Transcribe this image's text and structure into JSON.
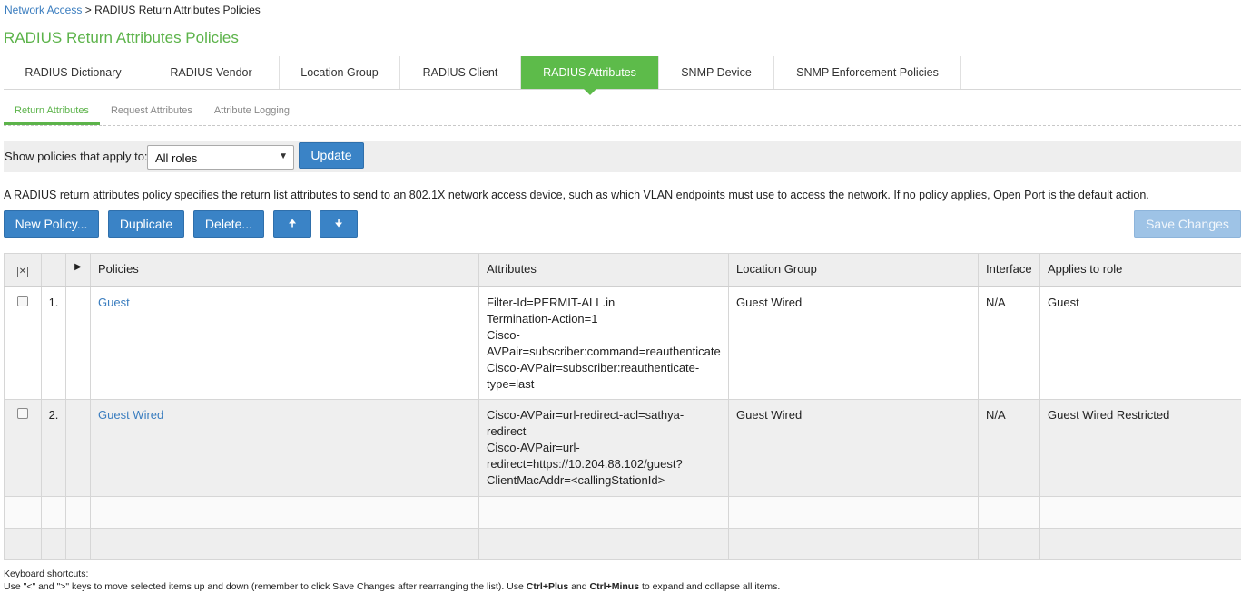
{
  "breadcrumb": {
    "link": "Network Access",
    "separator": ">",
    "current": "RADIUS Return Attributes Policies"
  },
  "page_title": "RADIUS Return Attributes Policies",
  "tabs": [
    {
      "label": "RADIUS Dictionary",
      "active": false
    },
    {
      "label": "RADIUS Vendor",
      "active": false
    },
    {
      "label": "Location Group",
      "active": false
    },
    {
      "label": "RADIUS Client",
      "active": false
    },
    {
      "label": "RADIUS Attributes",
      "active": true
    },
    {
      "label": "SNMP Device",
      "active": false
    },
    {
      "label": "SNMP Enforcement Policies",
      "active": false
    }
  ],
  "subtabs": [
    {
      "label": "Return Attributes",
      "active": true
    },
    {
      "label": "Request Attributes",
      "active": false
    },
    {
      "label": "Attribute Logging",
      "active": false
    }
  ],
  "filter": {
    "label": "Show policies that apply to:",
    "selected": "All roles",
    "update_label": "Update"
  },
  "description": "A RADIUS return attributes policy specifies the return list attributes to send to an 802.1X network access device, such as which VLAN endpoints must use to access the network. If no policy applies, Open Port is the default action.",
  "toolbar": {
    "new_label": "New Policy...",
    "duplicate_label": "Duplicate",
    "delete_label": "Delete...",
    "up_glyph": "🠉",
    "down_glyph": "🠋",
    "save_label": "Save Changes"
  },
  "table": {
    "headers": {
      "expand": "▶",
      "policies": "Policies",
      "attributes": "Attributes",
      "location_group": "Location Group",
      "interface": "Interface",
      "applies_to_role": "Applies to role"
    },
    "rows": [
      {
        "num": "1.",
        "policy": "Guest",
        "attributes": [
          "Filter-Id=PERMIT-ALL.in",
          "Termination-Action=1",
          "Cisco-",
          "AVPair=subscriber:command=reauthenticate",
          "Cisco-AVPair=subscriber:reauthenticate-",
          "type=last"
        ],
        "location_group": "Guest Wired",
        "interface": "N/A",
        "role": "Guest"
      },
      {
        "num": "2.",
        "policy": "Guest Wired",
        "attributes": [
          "Cisco-AVPair=url-redirect-acl=sathya-",
          "redirect",
          "Cisco-AVPair=url-",
          "redirect=https://10.204.88.102/guest?",
          "ClientMacAddr=<callingStationId>"
        ],
        "location_group": "Guest Wired",
        "interface": "N/A",
        "role": "Guest Wired Restricted"
      }
    ]
  },
  "shortcuts": {
    "title": "Keyboard shortcuts:",
    "line_a": "Use \"<\" and \">\" keys to move selected items up and down (remember to click Save Changes after rearranging the list). Use ",
    "key1": "Ctrl+Plus",
    "and": " and ",
    "key2": "Ctrl+Minus",
    "line_b": " to expand and collapse all items."
  },
  "colors": {
    "accent_green": "#5dbb4a",
    "button_blue": "#3a83c6",
    "link_blue": "#3a7dbf"
  }
}
